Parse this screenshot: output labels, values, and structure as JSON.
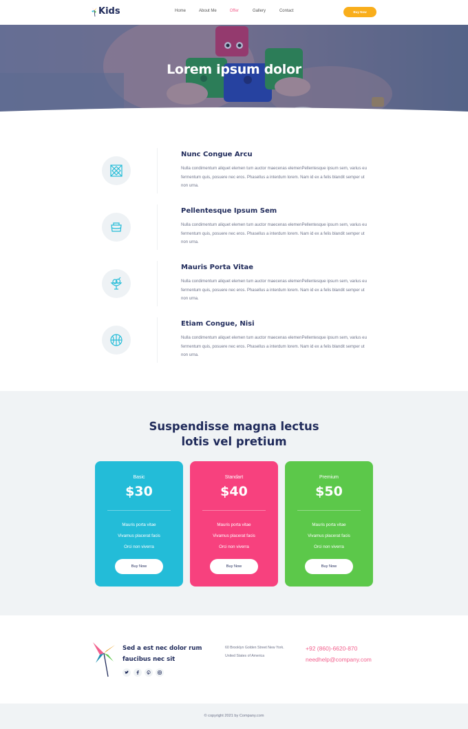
{
  "header": {
    "logo_text": "Kids",
    "nav": [
      {
        "label": "Home"
      },
      {
        "label": "About Me"
      },
      {
        "label": "Offer"
      },
      {
        "label": "Gallery"
      },
      {
        "label": "Contact"
      }
    ],
    "active_nav": "Offer",
    "buy_button": "Buy Now"
  },
  "hero": {
    "title": "Lorem ipsum dolor"
  },
  "features": [
    {
      "icon": "crossed-square-icon",
      "title": "Nunc Congue Arcu",
      "text": "Nulla condimentum aliquet elemen tum auctor maecenas elemenPellentesque ipsum sem, varius eu fermentum quis, posuere nec eros. Phasellus a interdum lorem. Nam id ex a felis blandit semper ut non urna."
    },
    {
      "icon": "basket-icon",
      "title": "Pellentesque Ipsum Sem",
      "text": "Nulla condimentum aliquet elemen tum auctor maecenas elemenPellentesque ipsum sem, varius eu fermentum quis, posuere nec eros. Phasellus a interdum lorem. Nam id ex a felis blandit semper ut non urna."
    },
    {
      "icon": "ice-cream-cup-icon",
      "title": "Mauris Porta Vitae",
      "text": "Nulla condimentum aliquet elemen tum auctor maecenas elemenPellentesque ipsum sem, varius eu fermentum quis, posuere nec eros. Phasellus a interdum lorem. Nam id ex a felis blandit semper ut non urna."
    },
    {
      "icon": "basketball-icon",
      "title": "Etiam Congue, Nisi",
      "text": "Nulla condimentum aliquet elemen tum auctor maecenas elemenPellentesque ipsum sem, varius eu fermentum quis, posuere nec eros. Phasellus a interdum lorem. Nam id ex a felis blandit semper ut non urna."
    }
  ],
  "pricing": {
    "title_line1": "Suspendisse magna lectus",
    "title_line2": "lotis vel pretium",
    "plans": [
      {
        "name": "Basic",
        "price": "$30",
        "color": "#23bcd8",
        "features": [
          "Mauris porta vitae",
          "Vivamus placerat facis",
          "Orci non viverra"
        ],
        "button": "Buy Now"
      },
      {
        "name": "Standart",
        "price": "$40",
        "color": "#f7417e",
        "features": [
          "Mauris porta vitae",
          "Vivamus placerat facis",
          "Orci non viverra"
        ],
        "button": "Buy Now"
      },
      {
        "name": "Premium",
        "price": "$50",
        "color": "#5cc84a",
        "features": [
          "Mauris porta vitae",
          "Vivamus placerat facis",
          "Orci non viverra"
        ],
        "button": "Buy Now"
      }
    ]
  },
  "footer": {
    "tagline_line1": "Sed a est nec dolor rum",
    "tagline_line2": "faucibus nec sit",
    "socials": [
      "twitter-icon",
      "facebook-icon",
      "pinterest-icon",
      "instagram-icon"
    ],
    "address_line1": "60 Brooklyn Golden Street New York.",
    "address_line2": "United States of America",
    "phone": "+92 (860)-6620-870",
    "email": "needhelp@company.com"
  },
  "copyright": "© copyright 2021 by Company.com",
  "colors": {
    "navy": "#1f2a5a",
    "accent_pink": "#f25f8c",
    "accent_orange": "#f9ae1b",
    "icon_teal": "#23bcd8"
  }
}
